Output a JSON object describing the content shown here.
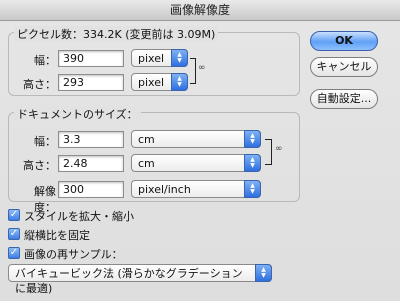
{
  "window": {
    "title": "画像解像度"
  },
  "pixel_dimensions": {
    "legend": "ピクセル数：334.2K (変更前は 3.09M)",
    "width": {
      "label": "幅：",
      "value": "390",
      "unit": "pixel"
    },
    "height": {
      "label": "高さ：",
      "value": "293",
      "unit": "pixel"
    }
  },
  "document_size": {
    "legend": "ドキュメントのサイズ：",
    "width": {
      "label": "幅：",
      "value": "3.3",
      "unit": "cm"
    },
    "height": {
      "label": "高さ：",
      "value": "2.48",
      "unit": "cm"
    },
    "resolution": {
      "label": "解像度：",
      "value": "300",
      "unit": "pixel/inch"
    }
  },
  "buttons": {
    "ok": "OK",
    "cancel": "キャンセル",
    "auto": "自動設定..."
  },
  "options": {
    "scale_styles": {
      "label": "スタイルを拡大・縮小",
      "checked": true
    },
    "constrain_proportions": {
      "label": "縦横比を固定",
      "checked": true
    },
    "resample": {
      "label": "画像の再サンプル：",
      "checked": true
    },
    "resample_method": "バイキュービック法 (滑らかなグラデーションに最適)"
  },
  "icons": {
    "select_arrows": "updown-arrows-icon",
    "link": "chain-link-icon"
  },
  "colors": {
    "accent": "#3d7fe6",
    "primary_button": "#5f9ff5"
  }
}
